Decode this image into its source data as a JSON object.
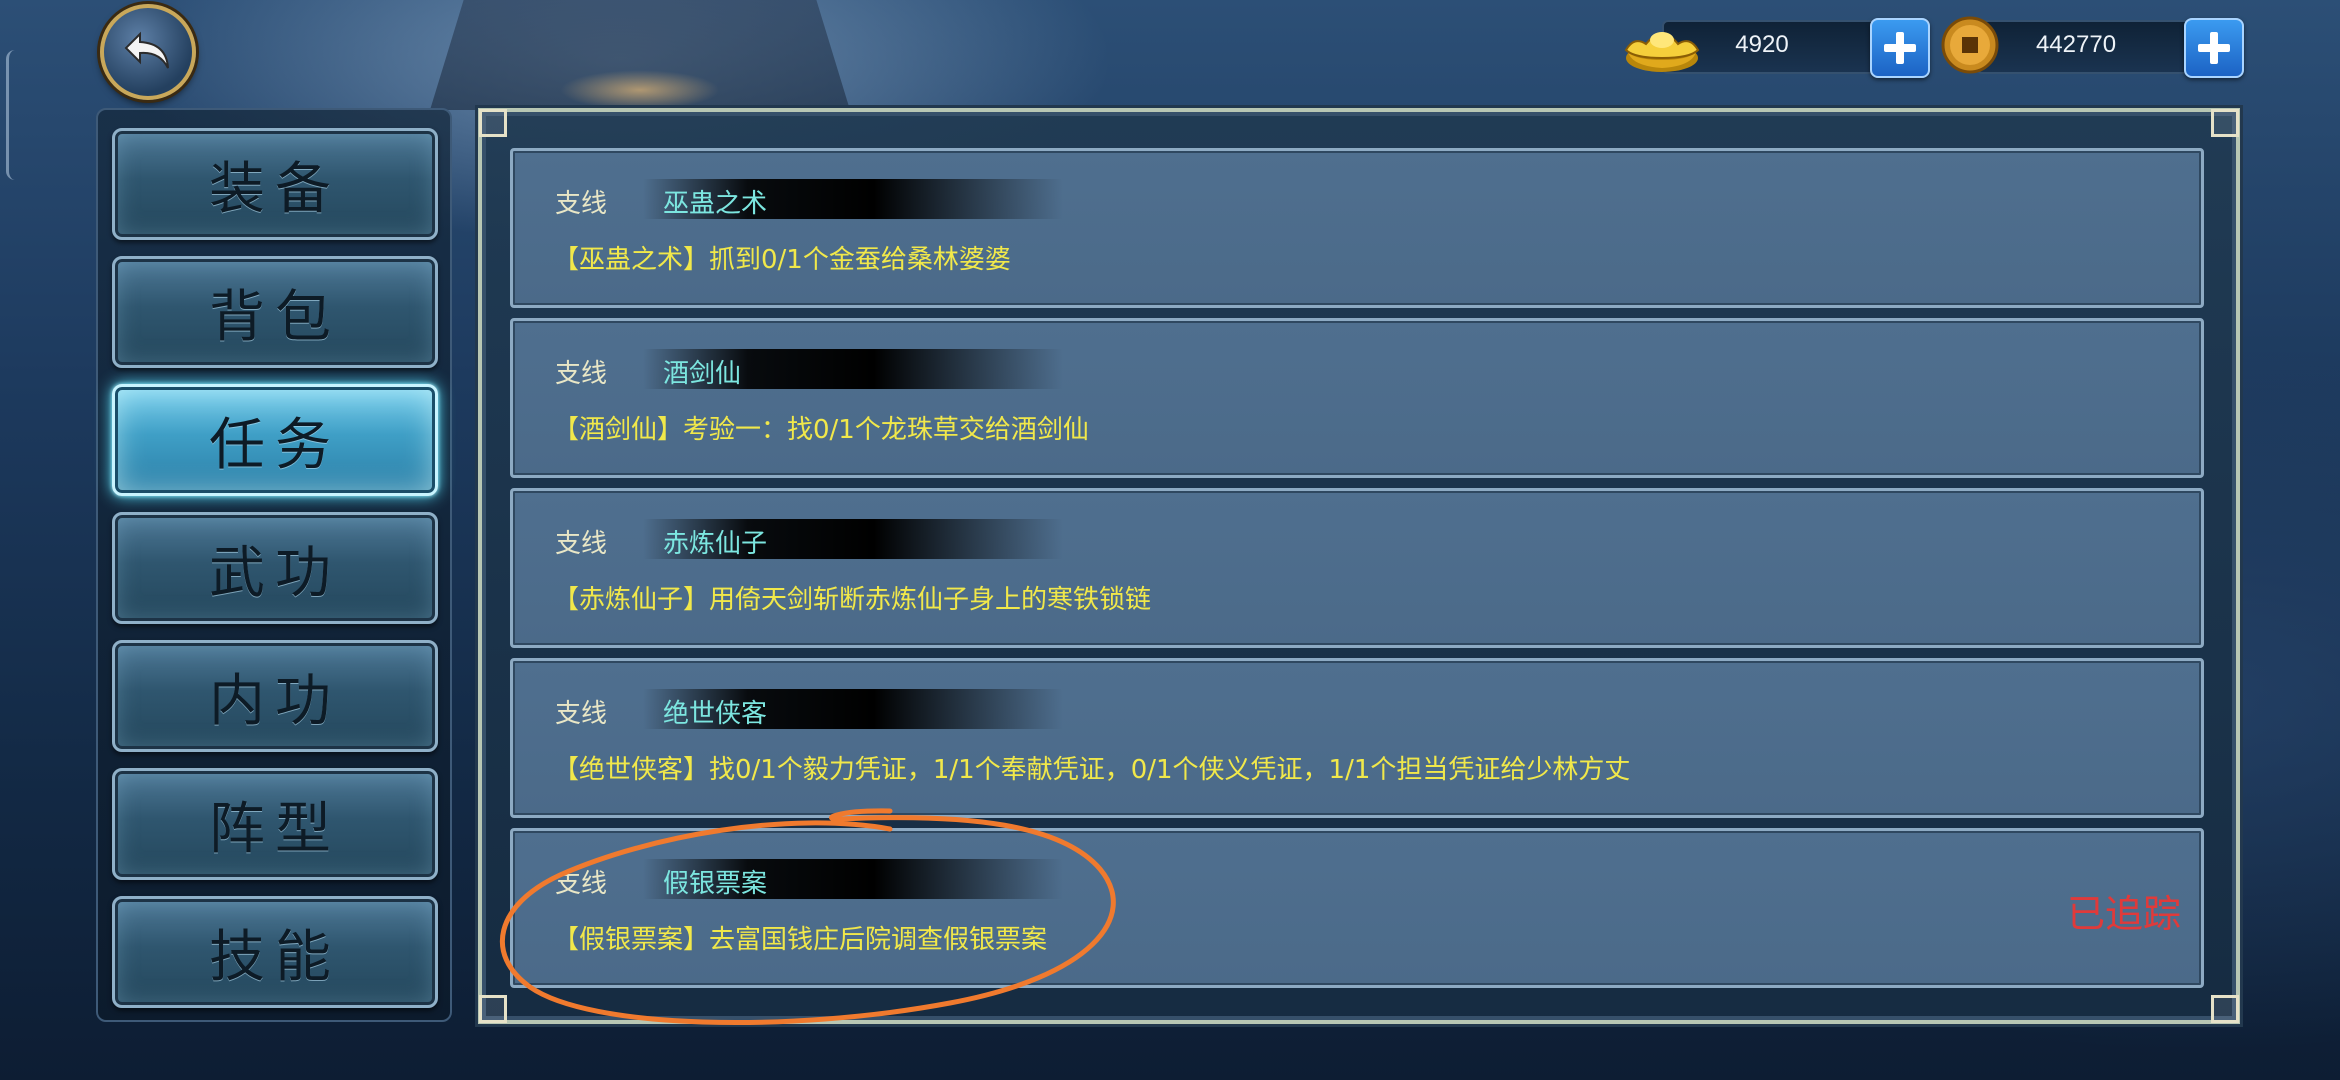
{
  "header": {
    "gold": {
      "icon": "gold-ingot-icon",
      "value": "4920"
    },
    "coins": {
      "icon": "copper-coin-icon",
      "value": "442770"
    }
  },
  "sidebar": {
    "items": [
      {
        "label": "装备",
        "active": false
      },
      {
        "label": "背包",
        "active": false
      },
      {
        "label": "任务",
        "active": true
      },
      {
        "label": "武功",
        "active": false
      },
      {
        "label": "内功",
        "active": false
      },
      {
        "label": "阵型",
        "active": false
      },
      {
        "label": "技能",
        "active": false
      }
    ]
  },
  "quests": [
    {
      "type": "支线",
      "name": "巫蛊之术",
      "desc": "【巫蛊之术】抓到0/1个金蚕给桑林婆婆",
      "status": ""
    },
    {
      "type": "支线",
      "name": "酒剑仙",
      "desc": "【酒剑仙】考验一：找0/1个龙珠草交给酒剑仙",
      "status": ""
    },
    {
      "type": "支线",
      "name": "赤炼仙子",
      "desc": "【赤炼仙子】用倚天剑斩断赤炼仙子身上的寒铁锁链",
      "status": ""
    },
    {
      "type": "支线",
      "name": "绝世侠客",
      "desc": "【绝世侠客】找0/1个毅力凭证，1/1个奉献凭证，0/1个侠义凭证，1/1个担当凭证给少林方丈",
      "status": ""
    },
    {
      "type": "支线",
      "name": "假银票案",
      "desc": "【假银票案】去富国钱庄后院调查假银票案",
      "status": "已追踪"
    }
  ],
  "colors": {
    "quest_type": "#e9e7c6",
    "quest_name": "#7ce6e0",
    "quest_desc": "#f1e84a",
    "tracked": "#e03a3a",
    "active_tab_glow": "#58e3ff",
    "annotation": "#f07a2e"
  }
}
